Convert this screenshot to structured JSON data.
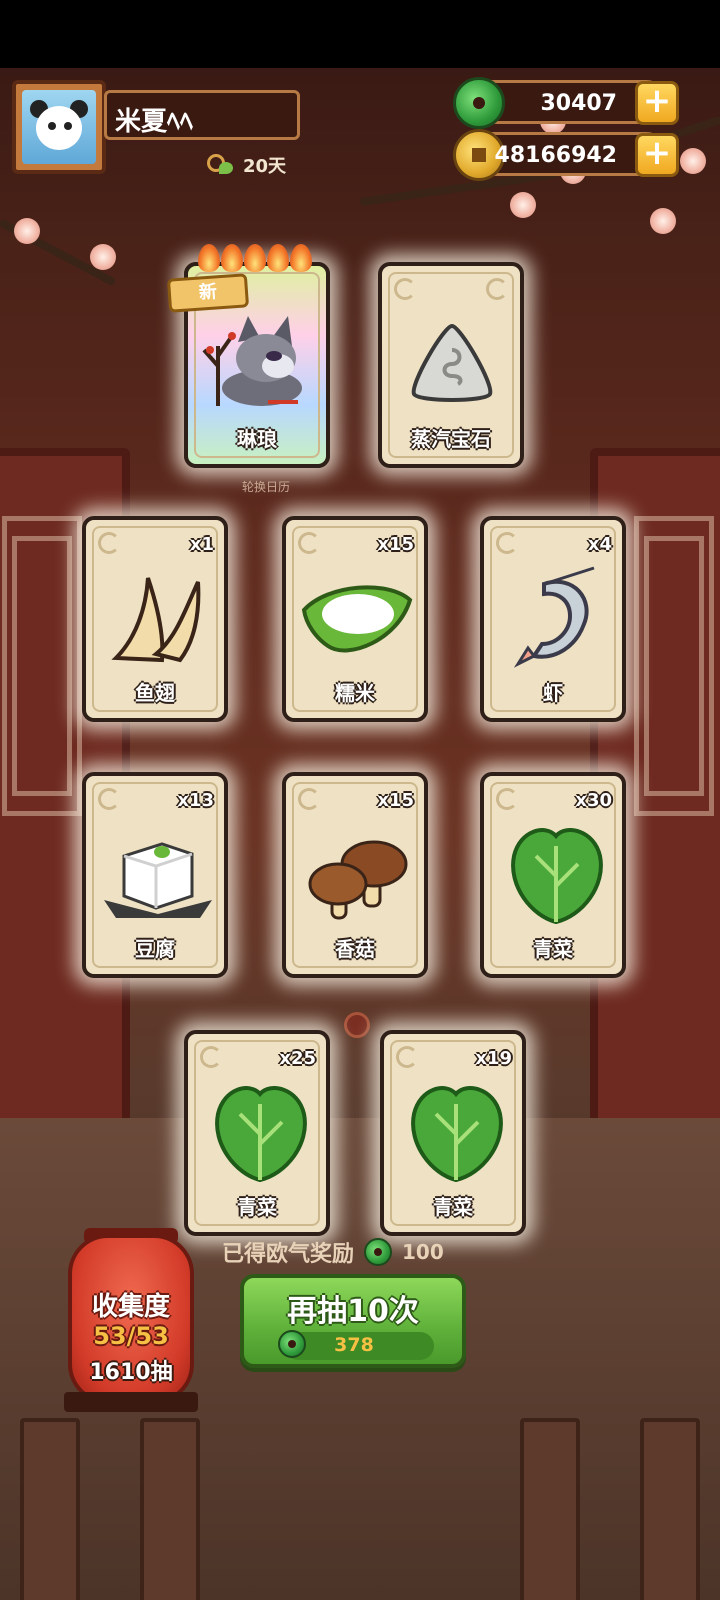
{
  "player": {
    "name": "米夏ﾍﾍ",
    "days": "20天"
  },
  "currency": [
    {
      "icon": "jade-icon",
      "value": "30407"
    },
    {
      "icon": "gold-coin-icon",
      "value": "48166942"
    }
  ],
  "featured": [
    {
      "label": "琳琅",
      "badge": "新",
      "art": "wolf-character-icon"
    },
    {
      "label": "蒸汽宝石",
      "art": "steam-gem-icon"
    }
  ],
  "featured_caption": "轮换日历",
  "items": [
    {
      "label": "鱼翅",
      "count": "x1",
      "art": "shark-fin-icon"
    },
    {
      "label": "糯米",
      "count": "x15",
      "art": "sticky-rice-icon"
    },
    {
      "label": "虾",
      "count": "x4",
      "art": "shrimp-icon"
    },
    {
      "label": "豆腐",
      "count": "x13",
      "art": "tofu-icon"
    },
    {
      "label": "香菇",
      "count": "x15",
      "art": "shiitake-icon"
    },
    {
      "label": "青菜",
      "count": "x30",
      "art": "bok-choy-icon"
    },
    {
      "label": "青菜",
      "count": "x25",
      "art": "bok-choy-icon"
    },
    {
      "label": "青菜",
      "count": "x19",
      "art": "bok-choy-icon"
    }
  ],
  "luck": {
    "label": "已得欧气奖励",
    "value": "100"
  },
  "collection": {
    "title": "收集度",
    "progress": "53/53",
    "draws": "1610抽"
  },
  "draw_button": {
    "label": "再抽10次",
    "cost": "378"
  }
}
